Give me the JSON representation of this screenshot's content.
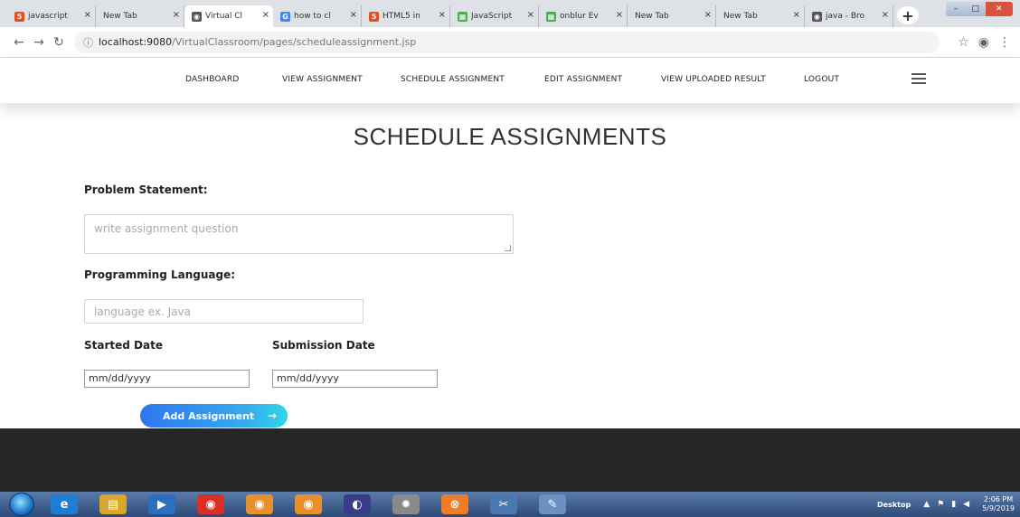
{
  "browser": {
    "tabs": [
      {
        "title": "javascript",
        "icon": "html5-icon",
        "color": "#e44d26",
        "glyph": "5"
      },
      {
        "title": "New Tab",
        "icon": "",
        "color": "",
        "glyph": ""
      },
      {
        "title": "Virtual Cl",
        "icon": "globe-icon",
        "color": "#555555",
        "glyph": "◉"
      },
      {
        "title": "how to cl",
        "icon": "google-icon",
        "color": "#4285f4",
        "glyph": "G"
      },
      {
        "title": "HTML5 in",
        "icon": "html5-icon",
        "color": "#e44d26",
        "glyph": "5"
      },
      {
        "title": "JavaScript",
        "icon": "w3schools-icon",
        "color": "#4caf50",
        "glyph": "▦"
      },
      {
        "title": "onblur Ev",
        "icon": "w3schools-icon",
        "color": "#4caf50",
        "glyph": "▦"
      },
      {
        "title": "New Tab",
        "icon": "",
        "color": "",
        "glyph": ""
      },
      {
        "title": "New Tab",
        "icon": "",
        "color": "",
        "glyph": ""
      },
      {
        "title": "java - Bro",
        "icon": "stackoverflow-icon",
        "color": "#555555",
        "glyph": "◉"
      }
    ],
    "active_tab": 2,
    "url_host": "localhost:9080",
    "url_path": "/VirtualClassroom/pages/scheduleassignment.jsp",
    "new_tab_glyph": "+"
  },
  "nav": {
    "items": [
      "DASHBOARD",
      "VIEW ASSIGNMENT",
      "SCHEDULE ASSIGNMENT",
      "EDIT ASSIGNMENT",
      "VIEW UPLOADED RESULT",
      "LOGOUT"
    ]
  },
  "page": {
    "title": "SCHEDULE ASSIGNMENTS"
  },
  "form": {
    "problem_label": "Problem Statement:",
    "problem_placeholder": "write assignment question",
    "language_label": "Programming Language:",
    "language_placeholder": "language ex. Java",
    "start_label": "Started Date",
    "start_value": "mm/dd/yyyy",
    "submit_label": "Submission Date",
    "submit_value": "mm/dd/yyyy",
    "button_label": "Add Assignment",
    "button_arrow": "→"
  },
  "taskbar": {
    "desktop_label": "Desktop",
    "time": "2:06 PM",
    "date": "5/9/2019",
    "icons": [
      {
        "name": "ie-icon",
        "glyph": "e",
        "color": "#1e7ed6"
      },
      {
        "name": "file-explorer-icon",
        "glyph": "▤",
        "color": "#d9a62e"
      },
      {
        "name": "media-player-icon",
        "glyph": "▶",
        "color": "#2a6fc0"
      },
      {
        "name": "chrome-icon",
        "glyph": "◉",
        "color": "#d93025"
      },
      {
        "name": "chrome-canary-icon",
        "glyph": "◉",
        "color": "#e8912c"
      },
      {
        "name": "chrome-dev-icon",
        "glyph": "◉",
        "color": "#e8912c"
      },
      {
        "name": "eclipse-icon",
        "glyph": "◐",
        "color": "#3b3b8c"
      },
      {
        "name": "settings-gear-icon",
        "glyph": "✹",
        "color": "#8a8a8a"
      },
      {
        "name": "xampp-icon",
        "glyph": "⊗",
        "color": "#f07c2a"
      },
      {
        "name": "snipping-tool-icon",
        "glyph": "✂",
        "color": "#4a78b0"
      },
      {
        "name": "paint-icon",
        "glyph": "✎",
        "color": "#6d8fc2"
      }
    ]
  }
}
